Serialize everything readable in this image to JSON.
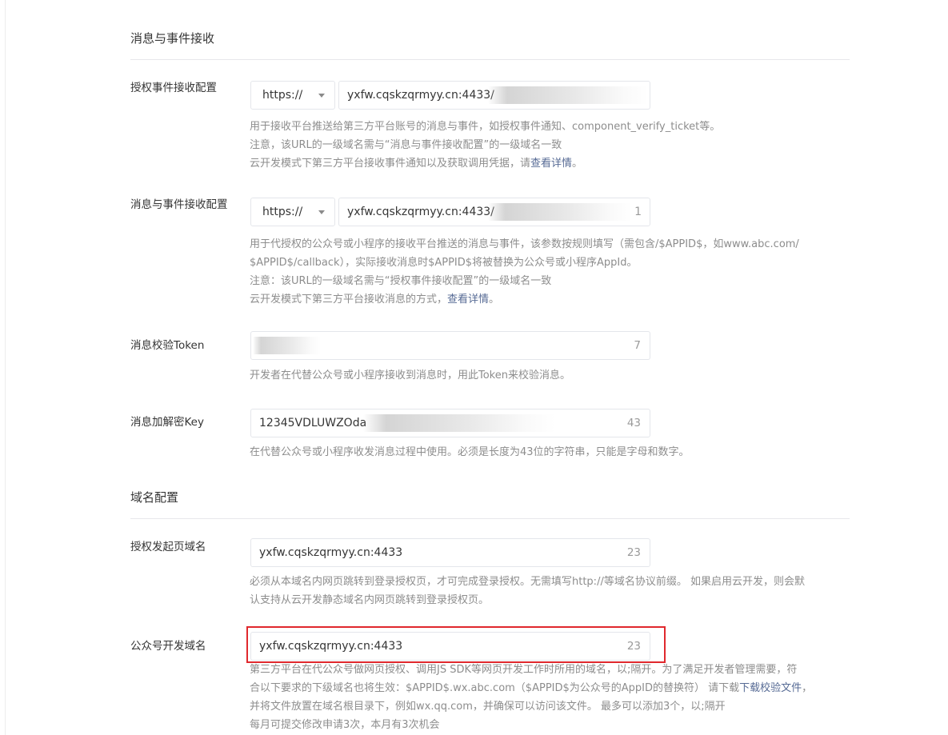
{
  "sections": {
    "message": {
      "title": "消息与事件接收"
    },
    "domain": {
      "title": "域名配置"
    }
  },
  "auth_event": {
    "label": "授权事件接收配置",
    "protocol": "https://",
    "url": "yxfw.cqskzqrmyy.cn:4433/",
    "help": [
      "用于接收平台推送给第三方平台账号的消息与事件，如授权事件通知、component_verify_ticket等。",
      "注意，该URL的一级域名需与“消息与事件接收配置”的一级域名一致"
    ],
    "help3_prefix": "云开发模式下第三方平台接收事件通知以及获取调用凭据，请",
    "help3_link": "查看详情",
    "help3_suffix": "。"
  },
  "msg_event": {
    "label": "消息与事件接收配置",
    "protocol": "https://",
    "url": "yxfw.cqskzqrmyy.cn:4433/",
    "url_tail": "1",
    "help": [
      "用于代授权的公众号或小程序的接收平台推送的消息与事件，该参数按规则填写（需包含/$APPID$，如www.abc.com/",
      "$APPID$/callback），实际接收消息时$APPID$将被替换为公众号或小程序AppId。",
      "注意：该URL的一级域名需与“授权事件接收配置”的一级域名一致"
    ],
    "help4_prefix": "云开发模式下第三方平台接收消息的方式，",
    "help4_link": "查看详情",
    "help4_suffix": "。"
  },
  "token": {
    "label": "消息校验Token",
    "count": "7",
    "help": "开发者在代替公众号或小程序接收到消息时，用此Token来校验消息。"
  },
  "aes_key": {
    "label": "消息加解密Key",
    "value": "12345VDLUWZOda",
    "count": "43",
    "help": "在代替公众号或小程序收发消息过程中使用。必须是长度为43位的字符串，只能是字母和数字。"
  },
  "auth_domain": {
    "label": "授权发起页域名",
    "value": "yxfw.cqskzqrmyy.cn:4433",
    "count": "23",
    "help": [
      "必须从本域名内网页跳转到登录授权页，才可完成登录授权。无需填写http://等域名协议前缀。 如果启用云开发，则会默",
      "认支持从云开发静态域名内网页跳转到登录授权页。"
    ]
  },
  "mp_domain": {
    "label": "公众号开发域名",
    "value": "yxfw.cqskzqrmyy.cn:4433",
    "count": "23",
    "help1": "第三方平台在代公众号做网页授权、调用JS SDK等网页开发工作时所用的域名，以;隔开。为了满足开发者管理需要，符",
    "help2_prefix": "合以下要求的下级域名也将生效：$APPID$.wx.abc.com（$APPID$为公众号的AppID的替换符） 请下载",
    "help2_link": "下载校验文件",
    "help2_suffix": "，",
    "help3": "并将文件放置在域名根目录下，例如wx.qq.com，并确保可以访问该文件。 最多可以添加3个，以;隔开",
    "help4": "每月可提交修改申请3次，本月有3次机会"
  },
  "colors": {
    "link": "#576b95",
    "highlight": "#e0282d",
    "hint": "#8d8d8d"
  }
}
